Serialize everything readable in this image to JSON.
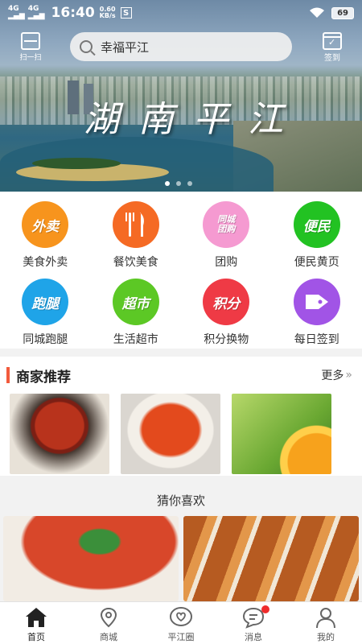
{
  "status_bar": {
    "signal1": "4G",
    "signal2": "4G",
    "time": "16:40",
    "net_speed": "0.60",
    "net_unit": "KB/s",
    "s_icon": "S",
    "battery": "69"
  },
  "header": {
    "scan_label": "扫一扫",
    "search_placeholder": "幸福平江",
    "signin_label": "签到",
    "banner_title": "湖南平江"
  },
  "categories": [
    {
      "icon_text": "外卖",
      "label": "美食外卖",
      "color": "#f7941d"
    },
    {
      "icon_text": "",
      "label": "餐饮美食",
      "color": "#f56a24"
    },
    {
      "icon_text": "同城团购",
      "label": "团购",
      "color": "#f59ad1"
    },
    {
      "icon_text": "便民",
      "label": "便民黄页",
      "color": "#22c222"
    },
    {
      "icon_text": "跑腿",
      "label": "同城跑腿",
      "color": "#1fa4e8"
    },
    {
      "icon_text": "超市",
      "label": "生活超市",
      "color": "#5cc825"
    },
    {
      "icon_text": "积分",
      "label": "积分换物",
      "color": "#ef3a45"
    },
    {
      "icon_text": "",
      "label": "每日签到",
      "color": "#a154e6"
    }
  ],
  "merchants": {
    "title": "商家推荐",
    "more": "更多"
  },
  "guess": {
    "title": "猜你喜欢"
  },
  "nav": {
    "items": [
      {
        "label": "首页"
      },
      {
        "label": "商城"
      },
      {
        "label": "平江圈"
      },
      {
        "label": "消息"
      },
      {
        "label": "我的"
      }
    ]
  }
}
